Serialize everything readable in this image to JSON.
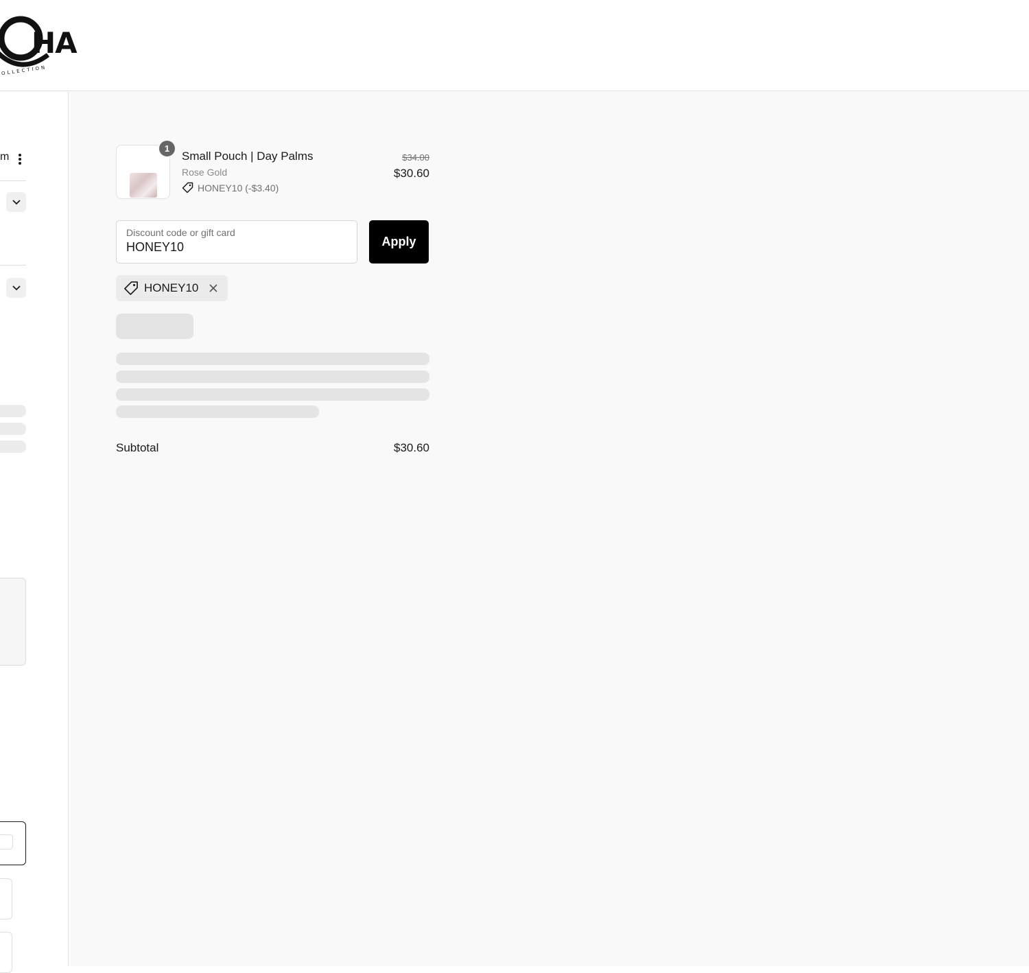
{
  "brand": {
    "logo_text": "HA",
    "tagline": "COLLECTION"
  },
  "contact": {
    "fragment": "m"
  },
  "order": {
    "item": {
      "quantity": "1",
      "title": "Small Pouch | Day Palms",
      "variant": "Rose Gold",
      "discount_note": "HONEY10 (-$3.40)",
      "original_price": "$34.00",
      "price": "$30.60"
    },
    "discount_field": {
      "label": "Discount code or gift card",
      "value": "HONEY10"
    },
    "apply_label": "Apply",
    "applied_code": "HONEY10",
    "subtotal_label": "Subtotal",
    "subtotal_value": "$30.60"
  },
  "colors": {
    "accent": "#000000",
    "summary_background": "#f9f9f9",
    "skeleton": "#e4e4e4"
  },
  "icons": [
    "more-vertical-icon",
    "chevron-down-icon",
    "tag-icon",
    "close-icon"
  ]
}
